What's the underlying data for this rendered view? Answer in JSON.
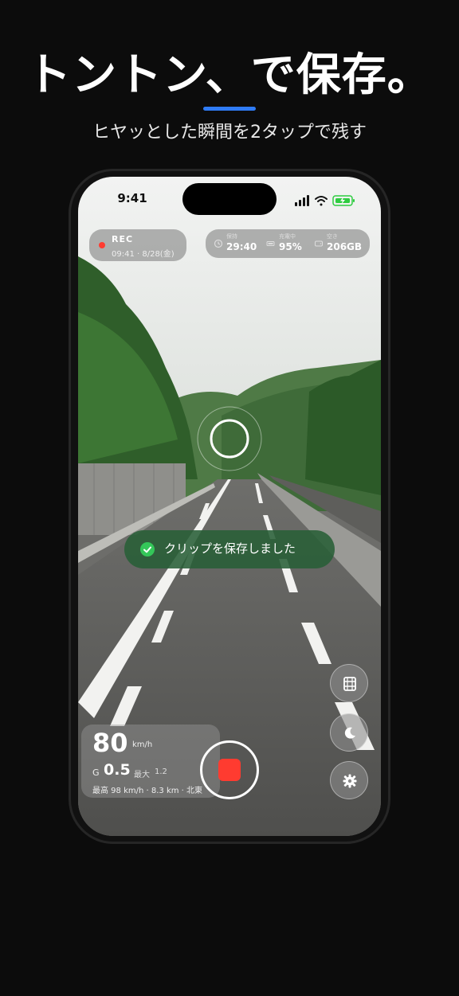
{
  "promo": {
    "headline": "トントン、で保存。",
    "subheadline": "ヒヤッとした瞬間を2タップで残す",
    "accent_color": "#2f7bf5"
  },
  "status_bar": {
    "time": "9:41",
    "icons": [
      "signal-icon",
      "wifi-icon",
      "battery-charging-icon"
    ]
  },
  "recording": {
    "label": "REC",
    "timestamp": "09:41 · 8/28(金)",
    "dot_color": "#ff3b30"
  },
  "stats": [
    {
      "icon": "history-icon",
      "label": "保持",
      "value": "29:40"
    },
    {
      "icon": "battery-icon",
      "label": "充電中",
      "value": "95%"
    },
    {
      "icon": "storage-icon",
      "label": "空き",
      "value": "206GB"
    }
  ],
  "toast": {
    "icon": "check-circle-icon",
    "message": "クリップを保存しました",
    "color": "#34c759"
  },
  "side_buttons": [
    "film-icon",
    "moon-icon",
    "gear-icon"
  ],
  "telemetry": {
    "speed": "80",
    "speed_unit": "km/h",
    "g_label": "G",
    "g_value": "0.5",
    "g_max_label": "最大",
    "g_max_value": "1.2",
    "summary": "最高 98 km/h · 8.3 km · 北東"
  },
  "record_button": {
    "icon": "stop-icon",
    "color": "#ff3b30"
  }
}
